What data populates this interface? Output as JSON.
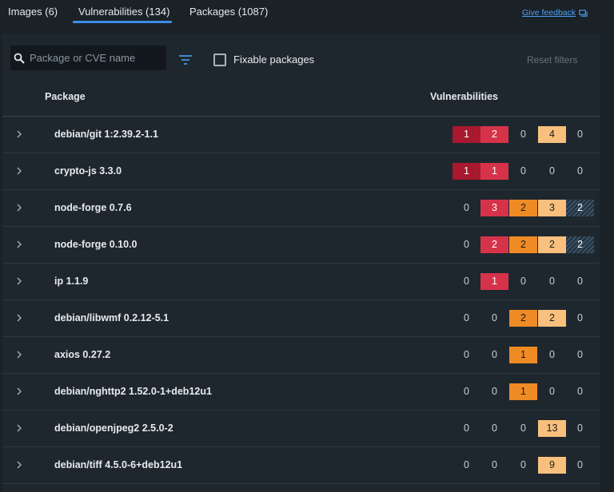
{
  "tabs": [
    {
      "label": "Images (6)"
    },
    {
      "label": "Vulnerabilities (134)"
    },
    {
      "label": "Packages (1087)"
    }
  ],
  "feedback_label": "Give feedback",
  "toolbar": {
    "search_placeholder": "Package or CVE name",
    "fixable_label": "Fixable packages",
    "reset_label": "Reset filters"
  },
  "table": {
    "col_package": "Package",
    "col_vulnerabilities": "Vulnerabilities",
    "rows": [
      {
        "package": "debian/git 1:2.39.2-1.1",
        "counts": [
          "1",
          "2",
          "0",
          "4",
          "0"
        ]
      },
      {
        "package": "crypto-js 3.3.0",
        "counts": [
          "1",
          "1",
          "0",
          "0",
          "0"
        ]
      },
      {
        "package": "node-forge 0.7.6",
        "counts": [
          "0",
          "3",
          "2",
          "3",
          "2"
        ]
      },
      {
        "package": "node-forge 0.10.0",
        "counts": [
          "0",
          "2",
          "2",
          "2",
          "2"
        ]
      },
      {
        "package": "ip 1.1.9",
        "counts": [
          "0",
          "1",
          "0",
          "0",
          "0"
        ]
      },
      {
        "package": "debian/libwmf 0.2.12-5.1",
        "counts": [
          "0",
          "0",
          "2",
          "2",
          "0"
        ]
      },
      {
        "package": "axios 0.27.2",
        "counts": [
          "0",
          "0",
          "1",
          "0",
          "0"
        ]
      },
      {
        "package": "debian/nghttp2 1.52.0-1+deb12u1",
        "counts": [
          "0",
          "0",
          "1",
          "0",
          "0"
        ]
      },
      {
        "package": "debian/openjpeg2 2.5.0-2",
        "counts": [
          "0",
          "0",
          "0",
          "13",
          "0"
        ]
      },
      {
        "package": "debian/tiff 4.5.0-6+deb12u1",
        "counts": [
          "0",
          "0",
          "0",
          "9",
          "0"
        ]
      }
    ]
  },
  "severity_colors": {
    "critical": "#a8182e",
    "high": "#d6334a",
    "medium": "#ee8b24",
    "low": "#f9c07d",
    "unspecified": "#3a5266"
  },
  "icons": [
    "search-icon",
    "filter-icon",
    "chevron-right-icon",
    "feedback-icon"
  ]
}
